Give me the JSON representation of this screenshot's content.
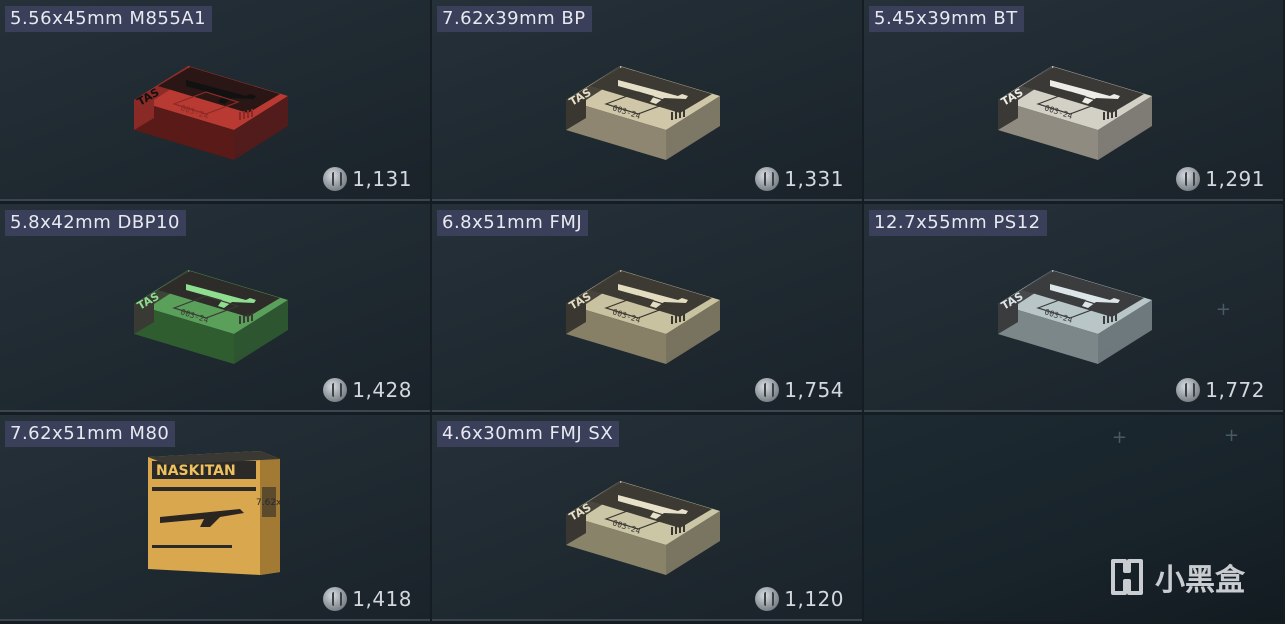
{
  "items": [
    {
      "name": "5.56x45mm M855A1",
      "price": "1,131",
      "box": {
        "front": "#b93a33",
        "top": "#8a2a26",
        "side": "#5a1a18",
        "label": "#2a1614",
        "print": "#111111"
      }
    },
    {
      "name": "7.62x39mm BP",
      "price": "1,331",
      "box": {
        "front": "#cfc7a8",
        "top": "#3a3630",
        "side": "#8e8670",
        "label": "#3d3a33",
        "print": "#e5dfc8"
      }
    },
    {
      "name": "5.45x39mm BT",
      "price": "1,291",
      "box": {
        "front": "#d3d0c6",
        "top": "#3b3936",
        "side": "#8f8b81",
        "label": "#3b3936",
        "print": "#eeece6"
      }
    },
    {
      "name": "5.8x42mm DBP10",
      "price": "1,428",
      "box": {
        "front": "#5aa05a",
        "top": "#3a3a34",
        "side": "#2f5d30",
        "label": "#2d2c28",
        "print": "#8fdd8f"
      }
    },
    {
      "name": "6.8x51mm FMJ",
      "price": "1,754",
      "box": {
        "front": "#c9c2a0",
        "top": "#3a3630",
        "side": "#878066",
        "label": "#3d3a33",
        "print": "#e3dcc0"
      }
    },
    {
      "name": "12.7x55mm PS12",
      "price": "1,772",
      "box": {
        "front": "#b8c6c8",
        "top": "#3a3c3e",
        "side": "#7b8789",
        "label": "#3a3c3e",
        "print": "#dce6e8"
      }
    },
    {
      "name": "7.62x51mm M80",
      "price": "1,418",
      "box": {
        "front": "#d9a84e",
        "top": "#2b2a28",
        "side": "#a27a33",
        "label": "#2b2a28",
        "print": "#f0c25e"
      },
      "brand": "NASKITAN",
      "caliber": "7.62x51"
    },
    {
      "name": "4.6x30mm FMJ SX",
      "price": "1,120",
      "box": {
        "front": "#cbc6a6",
        "top": "#3a3732",
        "side": "#898369",
        "label": "#3d3a33",
        "print": "#e6e1c8"
      }
    }
  ],
  "currency_icon": "coin-icon",
  "watermark": {
    "icon": "heybox-logo-icon",
    "text": "小黑盒"
  },
  "box_markings": {
    "brand": "TAS",
    "code": "003-24"
  }
}
